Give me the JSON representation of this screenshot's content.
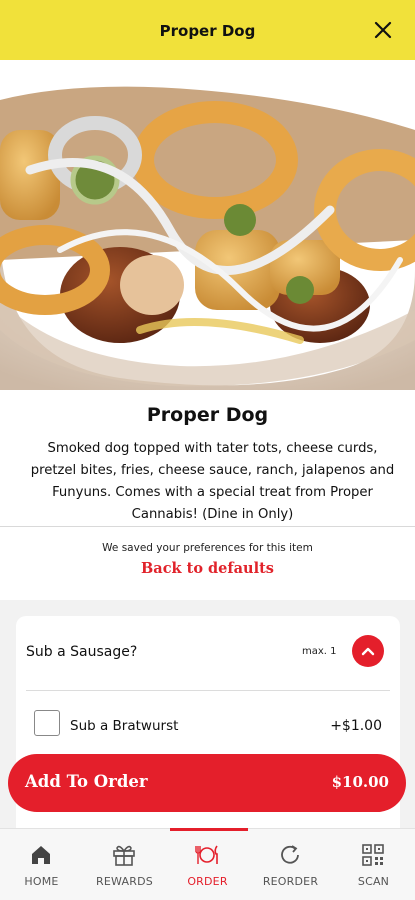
{
  "header": {
    "title": "Proper Dog"
  },
  "product": {
    "name": "Proper Dog",
    "description": "Smoked dog topped with tater tots, cheese curds, pretzel bites, fries, cheese sauce, ranch, jalapenos and Funyuns. Comes with a special treat from Proper Cannabis! (Dine in Only)",
    "image_subject": "hot dog topped with tater tots, onion rings, jalapenos and sauce"
  },
  "preferences": {
    "saved_text": "We saved your preferences for this item",
    "back_link": "Back to defaults"
  },
  "option_group": {
    "title": "Sub a Sausage?",
    "max_label": "max. 1",
    "options": [
      {
        "label": "Sub a Bratwurst",
        "price": "+$1.00",
        "checked": false
      }
    ]
  },
  "order": {
    "button_label": "Add To Order",
    "total": "$10.00"
  },
  "nav": {
    "items": [
      {
        "label": "HOME",
        "icon": "home-icon"
      },
      {
        "label": "REWARDS",
        "icon": "gift-icon"
      },
      {
        "label": "ORDER",
        "icon": "utensils-icon"
      },
      {
        "label": "REORDER",
        "icon": "reorder-icon"
      },
      {
        "label": "SCAN",
        "icon": "qr-code-icon"
      }
    ],
    "active": "ORDER"
  },
  "colors": {
    "header_bg": "#f1e13a",
    "accent": "#e41f2b"
  }
}
